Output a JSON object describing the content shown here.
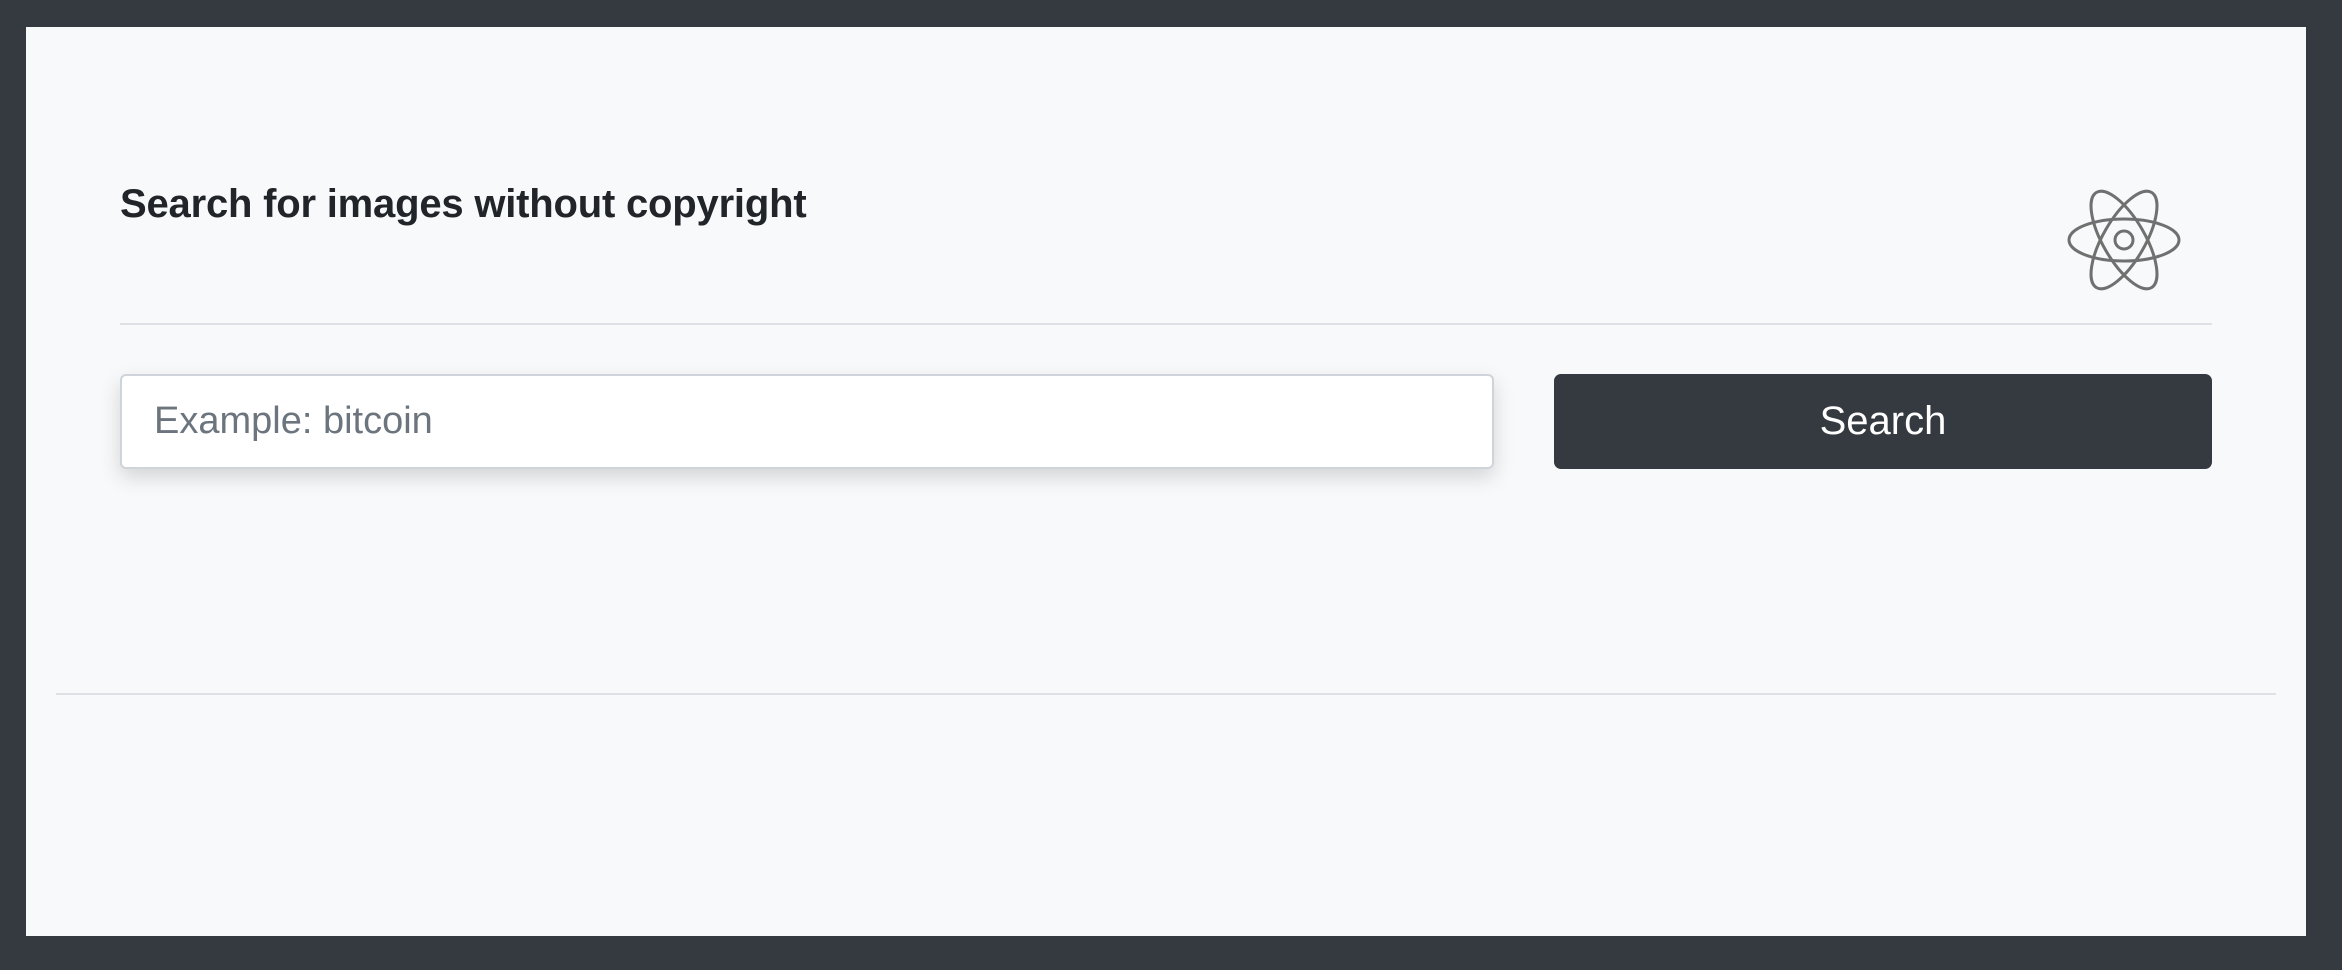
{
  "header": {
    "title": "Search for images without copyright",
    "logo_icon": "react-atom-icon"
  },
  "search": {
    "placeholder": "Example: bitcoin",
    "value": "",
    "button_label": "Search"
  },
  "colors": {
    "frame": "#343a40",
    "page_background": "#f8f9fa",
    "button_background": "#343a40",
    "button_text": "#ffffff",
    "title_text": "#212529",
    "placeholder_text": "#6c757d",
    "divider": "#dee2e6",
    "logo_stroke": "#707070"
  }
}
